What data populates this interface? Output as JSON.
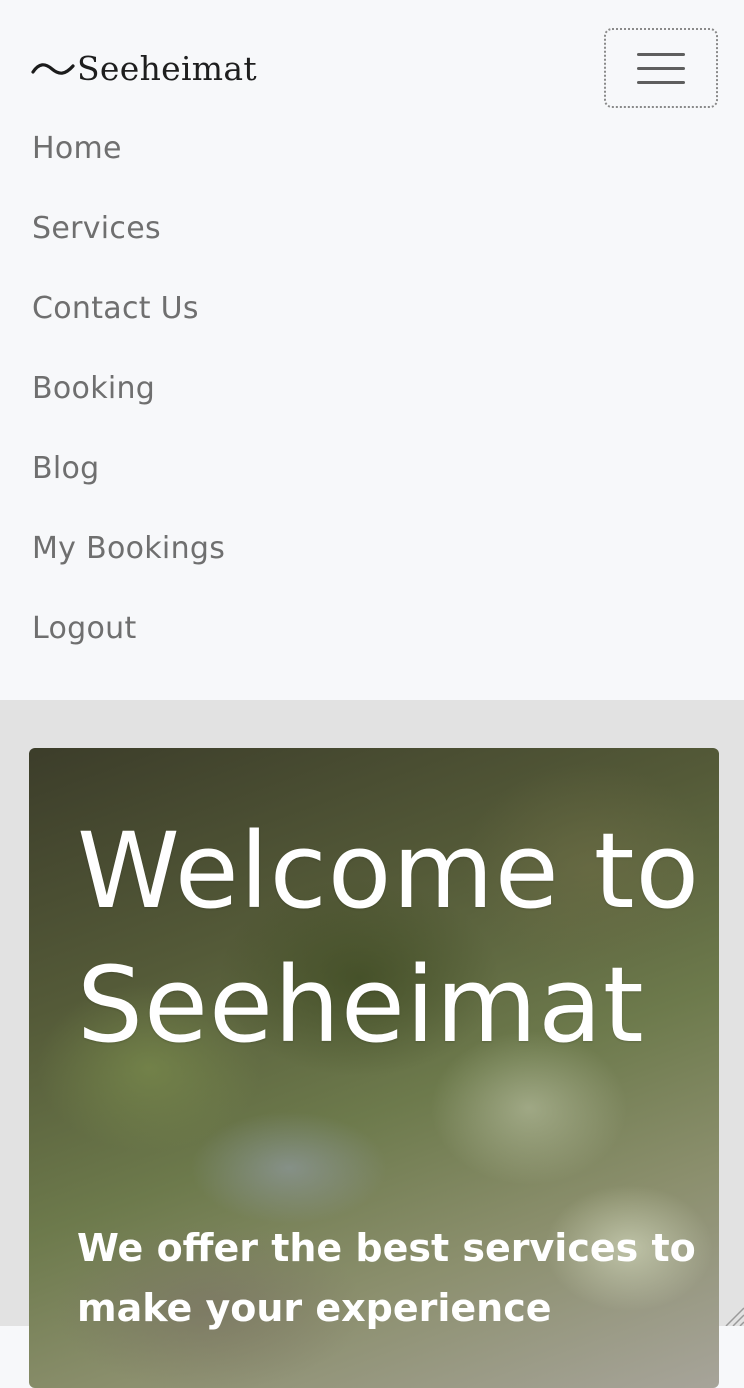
{
  "brand": {
    "name": "Seeheimat",
    "logo_icon": "wave-logo-icon"
  },
  "navbar": {
    "toggler_icon": "hamburger-menu-icon",
    "links": [
      {
        "label": "Home"
      },
      {
        "label": "Services"
      },
      {
        "label": "Contact Us"
      },
      {
        "label": "Booking"
      },
      {
        "label": "Blog"
      },
      {
        "label": "My Bookings"
      },
      {
        "label": "Logout"
      }
    ]
  },
  "hero": {
    "title": "Welcome to Seeheimat",
    "subtitle": "We offer the best services to make your experience"
  },
  "colors": {
    "nav_background": "#f7f8fa",
    "nav_link": "#6f6f6f",
    "content_background": "#e2e2e2",
    "hero_text": "#ffffff"
  }
}
